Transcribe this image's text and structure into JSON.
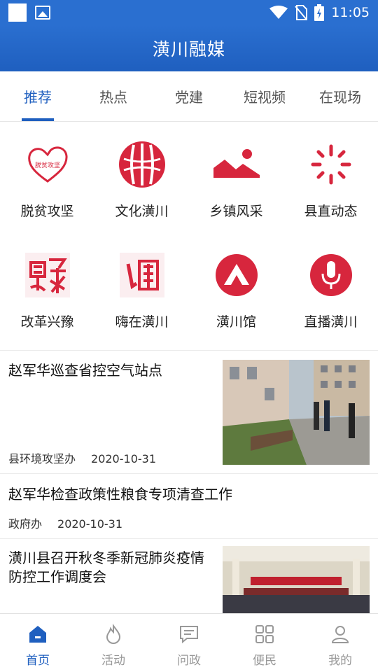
{
  "status_bar": {
    "time": "11:05"
  },
  "header": {
    "title": "潢川融媒"
  },
  "tabs": [
    {
      "label": "推荐",
      "active": true
    },
    {
      "label": "热点"
    },
    {
      "label": "党建"
    },
    {
      "label": "短视频"
    },
    {
      "label": "在现场"
    }
  ],
  "grid": [
    {
      "label": "脱贫攻坚",
      "icon": "heart-poverty-icon"
    },
    {
      "label": "文化潢川",
      "icon": "culture-emblem-icon"
    },
    {
      "label": "乡镇风采",
      "icon": "landscape-icon"
    },
    {
      "label": "县直动态",
      "icon": "loading-spinner-icon"
    },
    {
      "label": "改革兴豫",
      "icon": "reform-calligraphy-icon"
    },
    {
      "label": "嗨在潢川",
      "icon": "hai-calligraphy-icon"
    },
    {
      "label": "潢川馆",
      "icon": "mountain-circle-icon"
    },
    {
      "label": "直播潢川",
      "icon": "microphone-icon"
    }
  ],
  "grid_icon_text": {
    "poverty_icon_caption": "脱贫攻坚"
  },
  "news": [
    {
      "title": "赵军华巡查省控空气站点",
      "source": "县环境攻坚办",
      "date": "2020-10-31"
    },
    {
      "title": "赵军华检查政策性粮食专项清查工作",
      "source": "政府办",
      "date": "2020-10-31"
    },
    {
      "title": "潢川县召开秋冬季新冠肺炎疫情防控工作调度会"
    }
  ],
  "bottom_nav": [
    {
      "label": "首页",
      "icon": "home-icon",
      "active": true
    },
    {
      "label": "活动",
      "icon": "flame-icon"
    },
    {
      "label": "问政",
      "icon": "message-icon"
    },
    {
      "label": "便民",
      "icon": "apps-grid-icon"
    },
    {
      "label": "我的",
      "icon": "user-icon"
    }
  ],
  "colors": {
    "brand_blue": "#1f5fbf",
    "accent_red": "#d7263d"
  }
}
